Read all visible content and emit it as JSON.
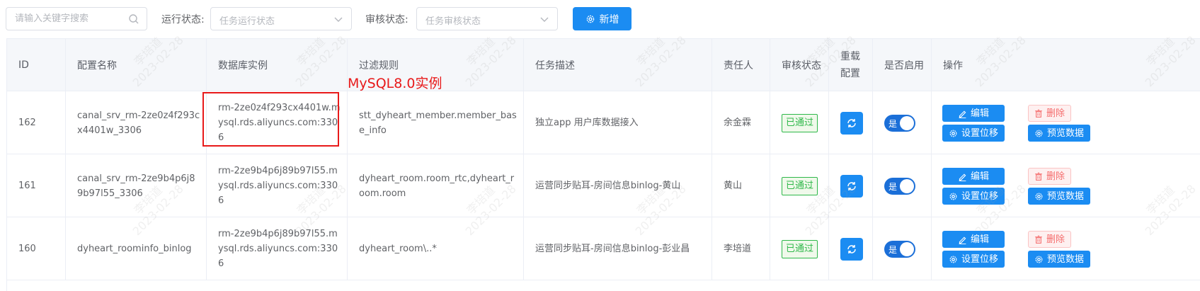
{
  "toolbar": {
    "search_placeholder": "请输入关键字搜索",
    "run_status_label": "运行状态:",
    "run_status_placeholder": "任务运行状态",
    "audit_status_label": "审核状态:",
    "audit_status_placeholder": "任务审核状态",
    "add_label": "新增"
  },
  "table": {
    "headers": {
      "id": "ID",
      "config_name": "配置名称",
      "db_instance": "数据库实例",
      "filter_rule": "过滤规则",
      "task_desc": "任务描述",
      "owner": "责任人",
      "audit_status": "审核状态",
      "reload_1": "重载",
      "reload_2": "配置",
      "enabled": "是否启用",
      "actions": "操作"
    },
    "rows": [
      {
        "id": "162",
        "config_name": "canal_srv_rm-2ze0z4f293cx4401w_3306",
        "db_instance": "rm-2ze0z4f293cx4401w.mysql.rds.aliyuncs.com:3306",
        "filter_rule": "stt_dyheart_member.member_base_info",
        "task_desc": "独立app 用户库数据接入",
        "owner": "余金霖",
        "audit_status": "已通过",
        "enabled": "是"
      },
      {
        "id": "161",
        "config_name": "canal_srv_rm-2ze9b4p6j89b97l55_3306",
        "db_instance": "rm-2ze9b4p6j89b97l55.mysql.rds.aliyuncs.com:3306",
        "filter_rule": "dyheart_room.room_rtc,dyheart_room.room",
        "task_desc": "运营同步贴耳-房间信息binlog-黄山",
        "owner": "黄山",
        "audit_status": "已通过",
        "enabled": "是"
      },
      {
        "id": "160",
        "config_name": "dyheart_roominfo_binlog",
        "db_instance": "rm-2ze9b4p6j89b97l55.mysql.rds.aliyuncs.com:3306",
        "filter_rule": "dyheart_room\\..*",
        "task_desc": "运营同步贴耳-房间信息binlog-彭业昌",
        "owner": "李培道",
        "audit_status": "已通过",
        "enabled": "是"
      }
    ],
    "actions": {
      "edit": "编辑",
      "delete": "删除",
      "set_offset": "设置位移",
      "preview": "预览数据"
    }
  },
  "annotation": "MySQL8.0实例",
  "watermark": {
    "name": "李培道",
    "date": "2023-02-28"
  },
  "colors": {
    "primary": "#1b8cf2",
    "success": "#2fb84a",
    "danger": "#f56c6c",
    "annotation": "#e81a1a"
  }
}
